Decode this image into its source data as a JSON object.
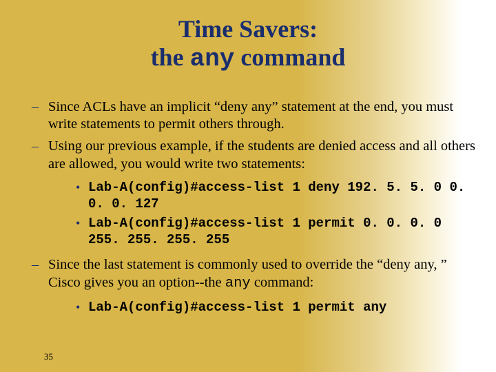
{
  "title": {
    "line1": "Time Savers:",
    "line2_pre": "the ",
    "line2_mono": "any",
    "line2_post": " command"
  },
  "bullets": {
    "b1": "Since ACLs have an implicit “deny any” statement at the end, you must write statements to permit others through.",
    "b2": "Using our previous example, if the students are denied access and all others are allowed, you would write two statements:",
    "code1": "Lab-A(config)#access-list 1 deny 192. 5. 5. 0 0. 0. 0. 127",
    "code2": "Lab-A(config)#access-list 1 permit 0. 0. 0. 0 255. 255. 255. 255",
    "b3_pre": "Since the last statement is commonly used to override the “deny any, ” Cisco gives you an option--the ",
    "b3_mono": "any",
    "b3_post": " command:",
    "code3": "Lab-A(config)#access-list 1 permit any"
  },
  "page_number": "35"
}
